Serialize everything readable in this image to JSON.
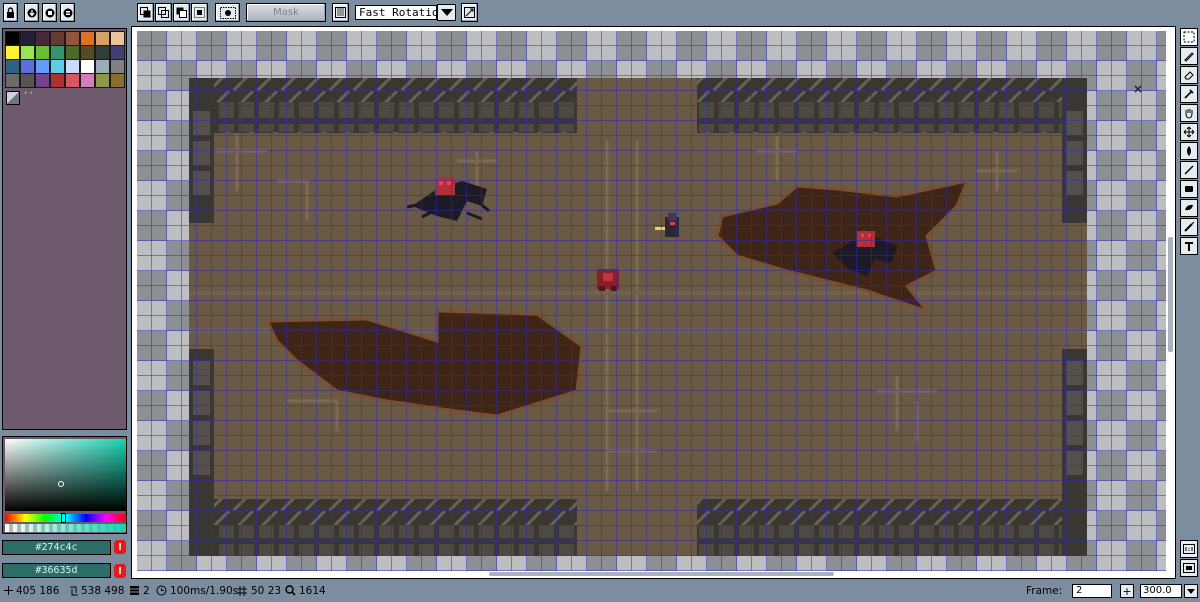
{
  "toolbar": {
    "lock_icon": "lock-icon",
    "mask_label": "Mask",
    "rotation_value": "Fast Rotation"
  },
  "palette": {
    "colors": [
      "#000000",
      "#222034",
      "#45283c",
      "#663931",
      "#8f563b",
      "#df7126",
      "#d9a066",
      "#eec39a",
      "#fbf236",
      "#99e550",
      "#6abe30",
      "#37946e",
      "#4b692f",
      "#524b24",
      "#323c39",
      "#3f3f74",
      "#306082",
      "#5b6ee1",
      "#639bff",
      "#5fcde4",
      "#cbdbfc",
      "#ffffff",
      "#9badb7",
      "#847e87",
      "#696a6a",
      "#595652",
      "#76428a",
      "#ac3232",
      "#d95763",
      "#d77bba",
      "#8f974a",
      "#8a6f30"
    ],
    "mini_label": "''"
  },
  "colors": {
    "foreground": "#274c4c",
    "background": "#36635d",
    "warning_mark": "!"
  },
  "status": {
    "cursor_pos": "405 186",
    "selection_size": "538 498",
    "layer": "2",
    "timing": "100ms/1.90s",
    "grid": "50 23",
    "zoom_pct": "1614",
    "frame_label": "Frame:",
    "frame_value": "2",
    "plus_label": "+",
    "zoom_value": "300.0"
  }
}
